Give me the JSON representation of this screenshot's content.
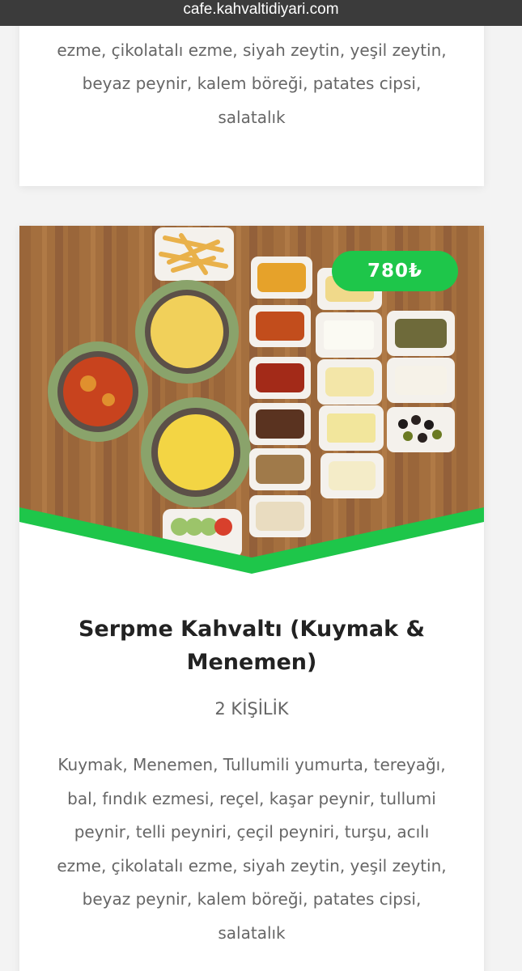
{
  "browser": {
    "url": "cafe.kahvaltidiyari.com"
  },
  "previous_item": {
    "description": "peynir, telli peyniri, çeçil peyniri, turşu, acılı ezme, çikolatalı ezme, siyah zeytin, yeşil zeytin, beyaz peynir, kalem böreği, patates cipsi, salatalık"
  },
  "item": {
    "price": "780₺",
    "title": "Serpme Kahvaltı (Kuymak & Menemen)",
    "persons": "2 KİŞİLİK",
    "description": "Kuymak, Menemen, Tullumili yumurta, tereyağı, bal, fındık ezmesi, reçel, kaşar peynir, tullumi peynir, telli peyniri, çeçil peyniri, turşu, acılı ezme, çikolatalı ezme, siyah zeytin, yeşil zeytin, beyaz peynir, kalem böreği, patates cipsi, salatalık"
  },
  "colors": {
    "accent": "#1ec64a",
    "table": "#a0703f"
  }
}
